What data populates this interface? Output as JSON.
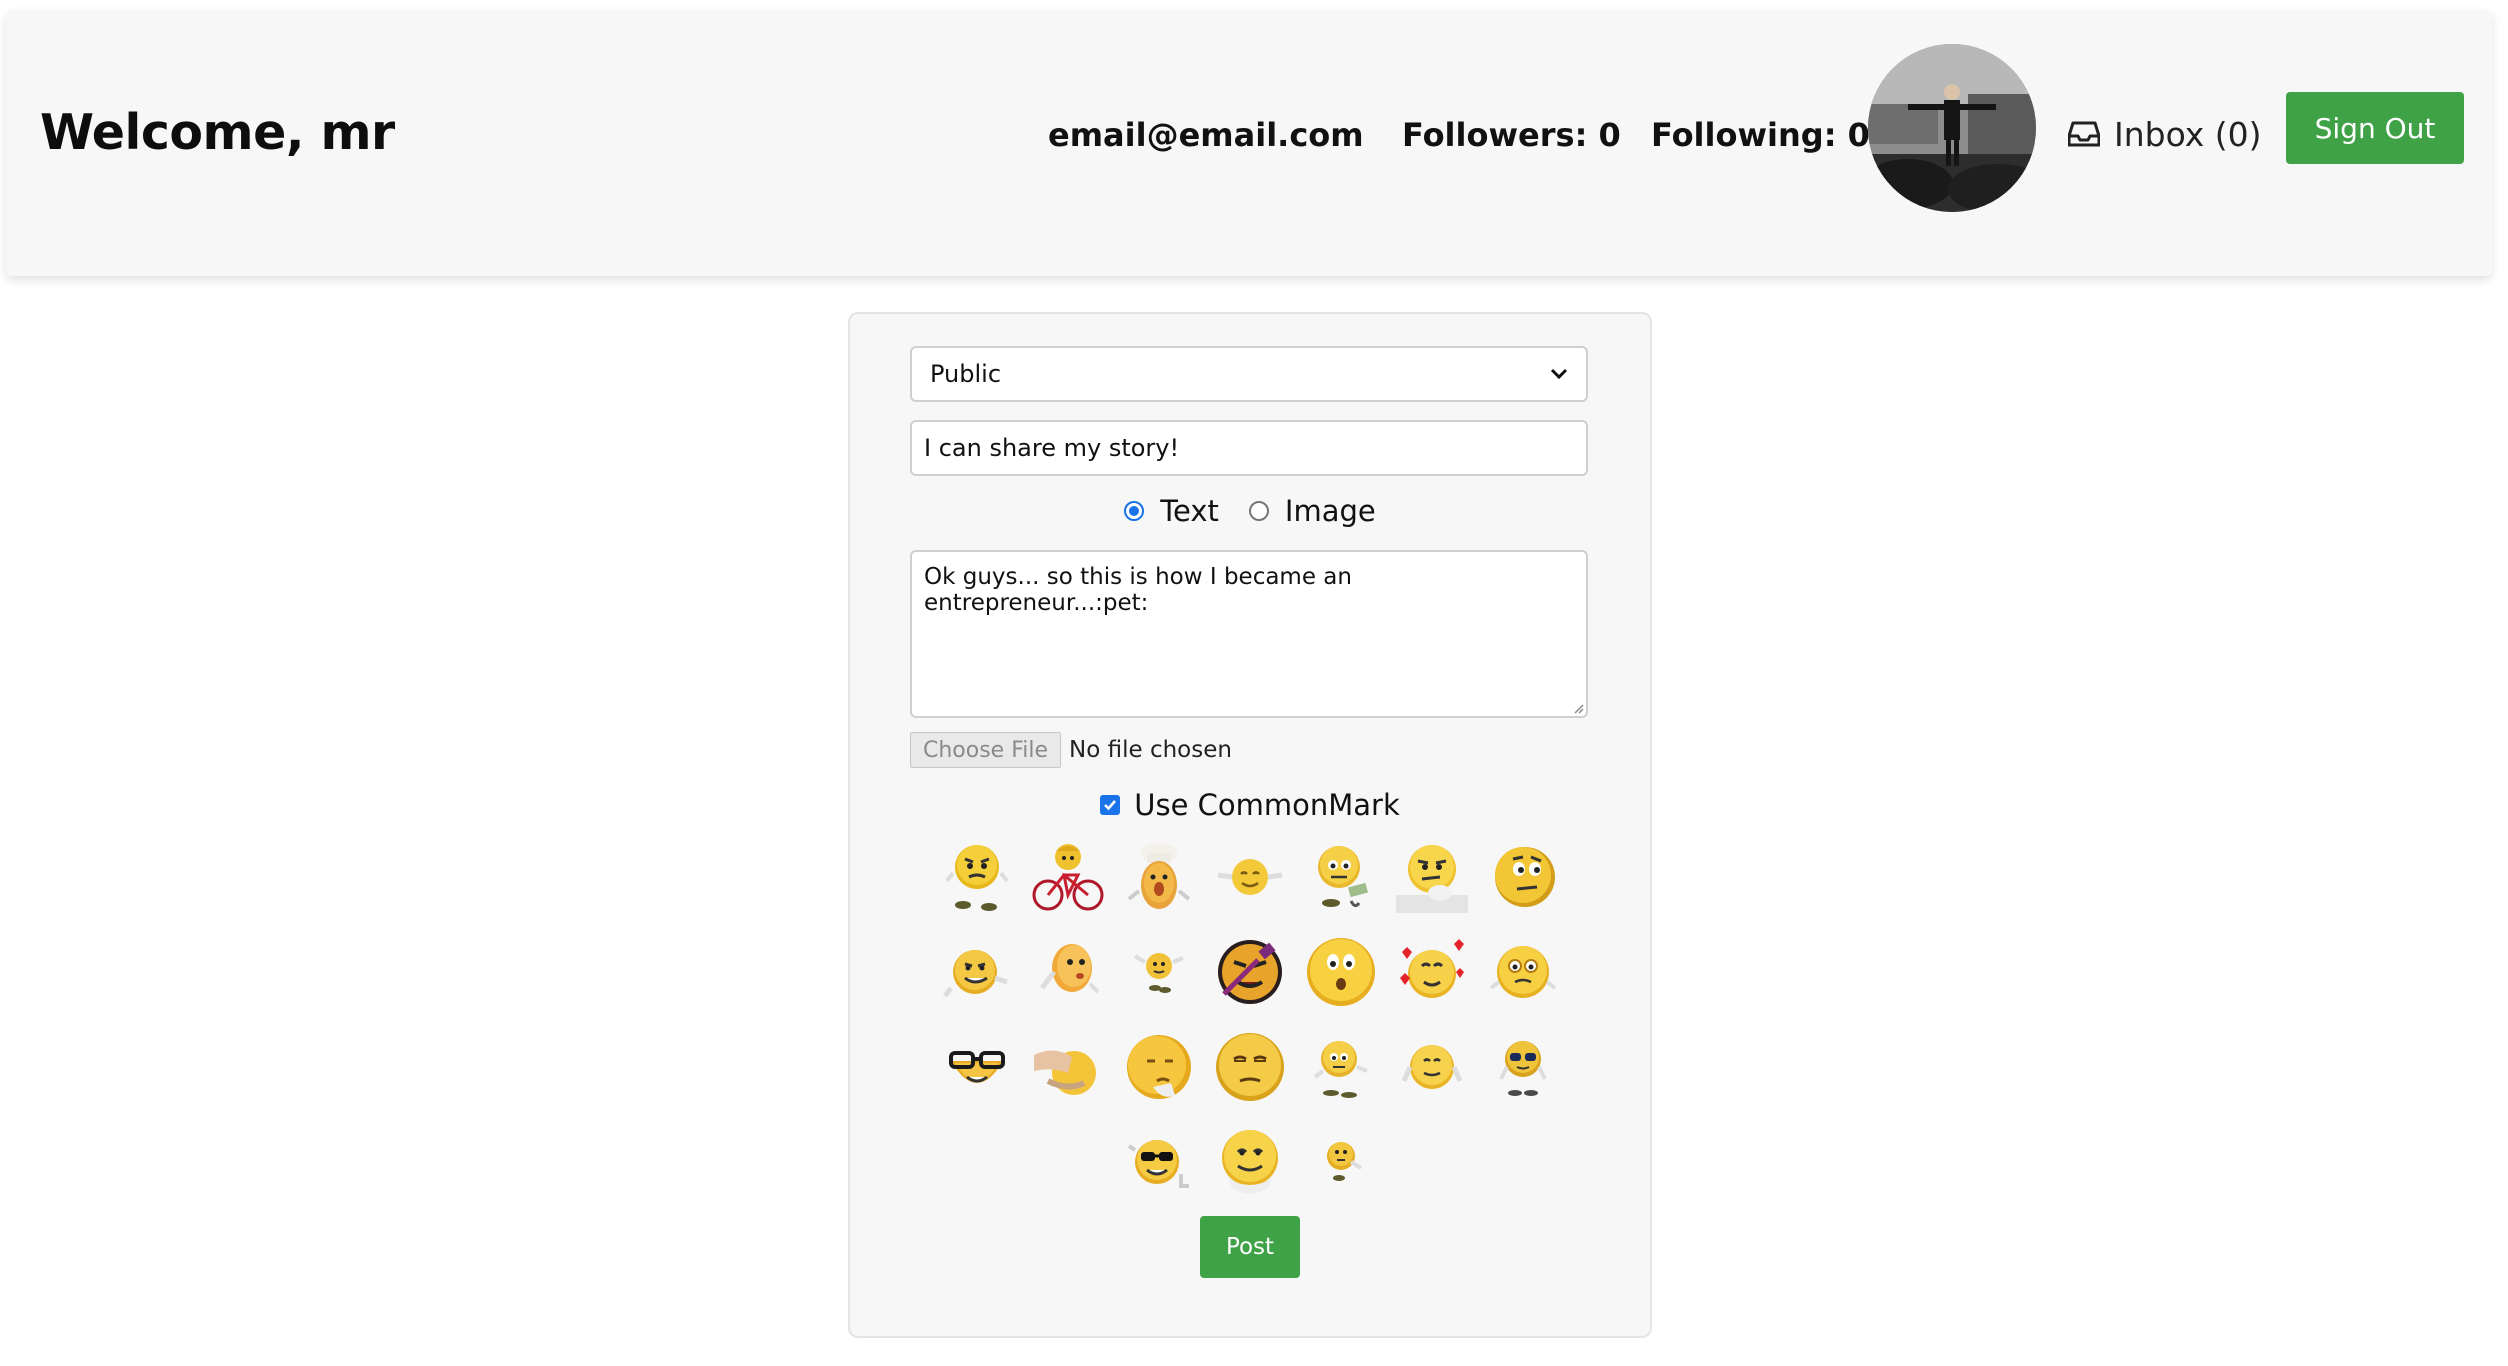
{
  "header": {
    "welcome": "Welcome, mr",
    "email": "email@email.com",
    "followers": "Followers: 0",
    "following": "Following: 0",
    "avatar_icon": "user-avatar-photo",
    "inbox_label": "Inbox (0)",
    "inbox_icon": "inbox-tray-icon",
    "signout_label": "Sign Out"
  },
  "form": {
    "visibility_selected": "Public",
    "title_value": "I can share my story!",
    "content_type_options": [
      "Text",
      "Image"
    ],
    "content_type_selected": "Text",
    "body_value": "Ok guys... so this is how I became an entrepreneur...:pet:",
    "file_button": "Choose File",
    "file_status": "No file chosen",
    "commonmark_label": "Use CommonMark",
    "commonmark_checked": true,
    "post_label": "Post",
    "emoji_count": 24
  },
  "colors": {
    "accent_green": "#3fa246",
    "checkbox_blue": "#1a73e8",
    "header_bg": "#f7f7f7"
  }
}
